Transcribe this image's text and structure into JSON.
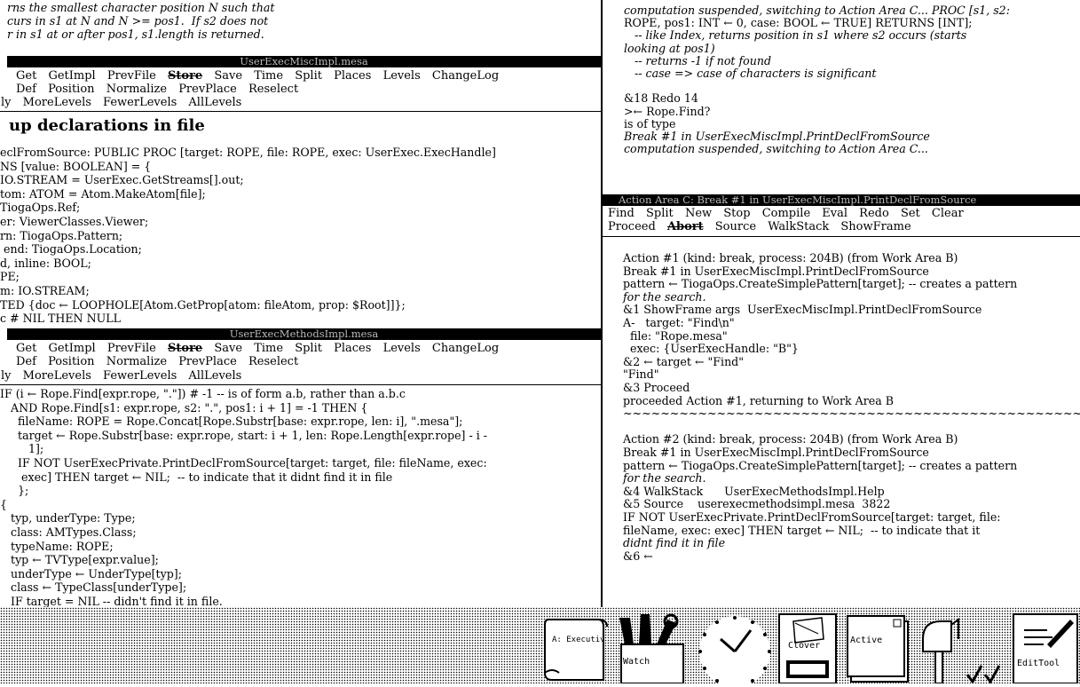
{
  "left_top": {
    "lines": [
      "rns the smallest character position N such that",
      "curs in s1 at N and N >= pos1.  If s2 does not",
      "r in s1 at or after pos1, s1.length is returned."
    ]
  },
  "window1": {
    "title": "UserExecMiscImpl.mesa",
    "menu_row1": [
      "Get",
      "GetImpl",
      "PrevFile",
      "Store",
      "Save",
      "Time",
      "Split",
      "Places",
      "Levels",
      "ChangeLog"
    ],
    "menu_row2": [
      "Def",
      "Position",
      "Normalize",
      "PrevPlace",
      "Reselect"
    ],
    "menu_row3": [
      "ly",
      "MoreLevels",
      "FewerLevels",
      "AllLevels"
    ],
    "heading": "up declarations in file",
    "code": [
      "eclFromSource: PUBLIC PROC [target: ROPE, file: ROPE, exec: UserExec.ExecHandle]",
      "NS [value: BOOLEAN] = {",
      "IO.STREAM = UserExec.GetStreams[].out;",
      "tom: ATOM = Atom.MakeAtom[file];",
      "TiogaOps.Ref;",
      "er: ViewerClasses.Viewer;",
      "rn: TiogaOps.Pattern;",
      " end: TiogaOps.Location;",
      "d, inline: BOOL;",
      "PE;",
      "m: IO.STREAM;",
      "TED {doc ← LOOPHOLE[Atom.GetProp[atom: fileAtom, prop: $Root]]};",
      "c # NIL THEN NULL"
    ]
  },
  "window2": {
    "title": "UserExecMethodsImpl.mesa",
    "menu_row1": [
      "Get",
      "GetImpl",
      "PrevFile",
      "Store",
      "Save",
      "Time",
      "Split",
      "Places",
      "Levels",
      "ChangeLog"
    ],
    "menu_row2": [
      "Def",
      "Position",
      "Normalize",
      "PrevPlace",
      "Reselect"
    ],
    "menu_row3": [
      "ly",
      "MoreLevels",
      "FewerLevels",
      "AllLevels"
    ],
    "code": [
      "IF (i ← Rope.Find[expr.rope, \".\"]) # -1 -- is of form a.b, rather than a.b.c",
      "   AND Rope.Find[s1: expr.rope, s2: \".\", pos1: i + 1] = -1 THEN {",
      "     fileName: ROPE = Rope.Concat[Rope.Substr[base: expr.rope, len: i], \".mesa\"];",
      "     target ← Rope.Substr[base: expr.rope, start: i + 1, len: Rope.Length[expr.rope] - i -",
      "        1];",
      "     IF NOT UserExecPrivate.PrintDeclFromSource[target: target, file: fileName, exec:",
      "      exec] THEN target ← NIL;  -- to indicate that it didnt find it in file",
      "     };",
      "{",
      "   typ, underType: Type;",
      "   class: AMTypes.Class;",
      "   typeName: ROPE;",
      "   typ ← TVType[expr.value];",
      "   underType ← UnderType[typ];",
      "   class ← TypeClass[underType];",
      "   IF target = NIL -- didn't find it in file."
    ]
  },
  "right_top": {
    "lines": [
      "computation suspended, switching to Action Area C... PROC [s1, s2:",
      "ROPE, pos1: INT ← 0, case: BOOL ← TRUE] RETURNS [INT];",
      "   -- like Index, returns position in s1 where s2 occurs (starts",
      "looking at pos1)",
      "   -- returns -1 if not found",
      "   -- case => case of characters is significant",
      "",
      "&18 Redo 14",
      ">← Rope.Find?",
      "is of type",
      "Break #1 in UserExecMiscImpl.PrintDeclFromSource",
      "computation suspended, switching to Action Area C..."
    ]
  },
  "action_window": {
    "title": "Action Area C: Break #1 in UserExecMiscImpl.PrintDeclFromSource",
    "menu_row1": [
      "Find",
      "Split",
      "New",
      "Stop",
      "Compile",
      "Eval",
      "Redo",
      "Set",
      "Clear"
    ],
    "menu_row2": [
      "Proceed",
      "Abort",
      "Source",
      "WalkStack",
      "ShowFrame"
    ],
    "lines": [
      "Action #1 (kind: break, process: 204B) (from Work Area B)",
      "Break #1 in UserExecMiscImpl.PrintDeclFromSource",
      "pattern ← TiogaOps.CreateSimplePattern[target]; -- creates a pattern",
      "for the search.",
      "&1 ShowFrame args  UserExecMiscImpl.PrintDeclFromSource",
      "A-   target: \"Find\\n\"",
      "  file: \"Rope.mesa\"",
      "  exec: {UserExecHandle: \"B\"}",
      "&2 ← target ← \"Find\"",
      "\"Find\"",
      "&3 Proceed",
      "proceeded Action #1, returning to Work Area B",
      "~~~~~~~~~~~~~~~~~~~~~~~~~~~~~~~~~~~~~~~~~~~~~~~~~~~~~~~~~",
      "",
      "Action #2 (kind: break, process: 204B) (from Work Area B)",
      "Break #1 in UserExecMiscImpl.PrintDeclFromSource",
      "pattern ← TiogaOps.CreateSimplePattern[target]; -- creates a pattern",
      "for the search.",
      "&4 WalkStack      UserExecMethodsImpl.Help",
      "&5 Source    userexecmethodsimpl.mesa  3822",
      "IF NOT UserExecPrivate.PrintDeclFromSource[target: target, file:",
      "fileName, exec: exec] THEN target ← NIL;  -- to indicate that it",
      "didnt find it in file",
      "&6 ←"
    ]
  },
  "icons": {
    "executive": "A: Executiv",
    "watch": "Watch",
    "clover": "Clover",
    "active": "Active",
    "edittool": "EditTool"
  }
}
